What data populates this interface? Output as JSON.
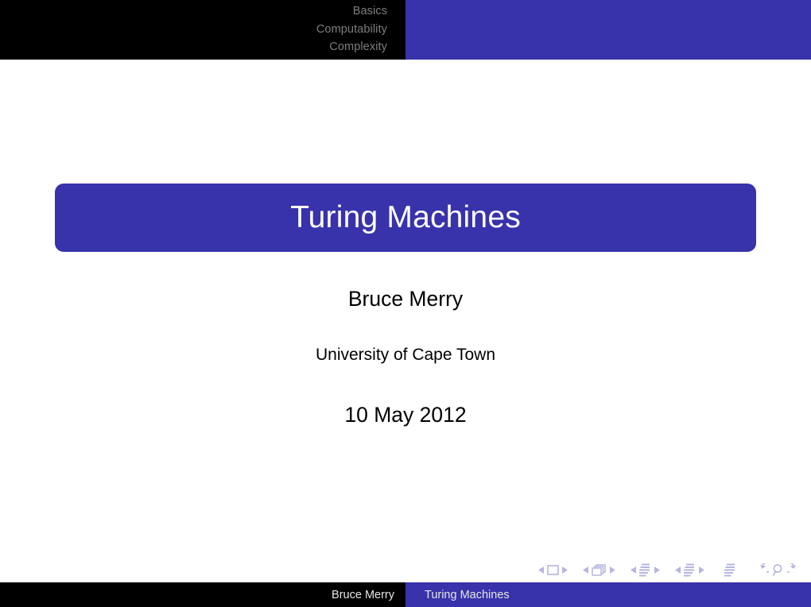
{
  "slide": {
    "kind": "beamer-title-slide",
    "theme_accent_color": "#3832ab",
    "header_bg_color": "#000000",
    "header_text_color": "#7d7d7d",
    "nav_symbol_color": "#b6b6e0"
  },
  "header": {
    "sections": [
      {
        "label": "Basics"
      },
      {
        "label": "Computability"
      },
      {
        "label": "Complexity"
      }
    ]
  },
  "title": {
    "text": "Turing Machines"
  },
  "meta": {
    "author": "Bruce Merry",
    "institute": "University of Cape Town",
    "date": "10 May 2012"
  },
  "navigation_symbols": {
    "groups": [
      {
        "name": "slide",
        "prev_label": "previous-slide",
        "target_label": "slide",
        "next_label": "next-slide"
      },
      {
        "name": "frame",
        "prev_label": "previous-frame",
        "target_label": "frame",
        "next_label": "next-frame"
      },
      {
        "name": "subsection",
        "prev_label": "previous-subsection",
        "target_label": "subsection",
        "next_label": "next-subsection"
      },
      {
        "name": "section",
        "prev_label": "previous-section",
        "target_label": "section",
        "next_label": "next-section"
      }
    ],
    "document_label": "document",
    "back_label": "go-back",
    "search_label": "search",
    "forward_label": "go-forward"
  },
  "footer": {
    "left_text": "Bruce Merry",
    "right_text": "Turing Machines"
  }
}
